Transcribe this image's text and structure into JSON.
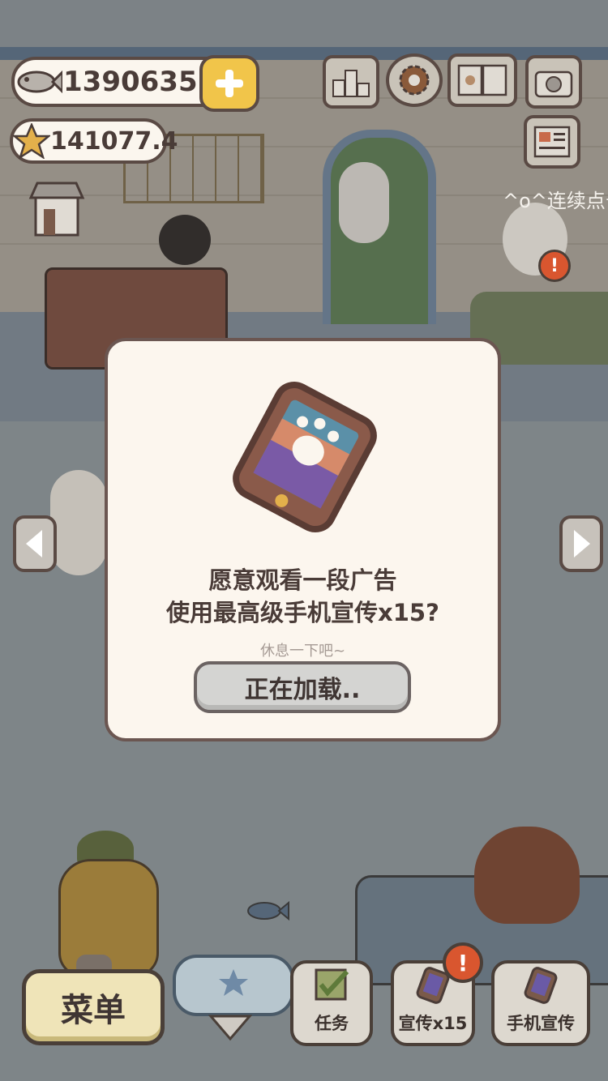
{
  "hud": {
    "fish_count": "1390635",
    "star_count": "141077.4",
    "tap_hint": "^o^连续点击"
  },
  "dialog": {
    "line1": "愿意观看一段广告",
    "line2": "使用最高级手机宣传x15?",
    "hint": "休息一下吧~",
    "button_label": "正在加载.."
  },
  "bottom_bar": {
    "menu_label": "菜单",
    "tasks_label": "任务",
    "promo15_label": "宣传x15",
    "phone_promo_label": "手机宣传",
    "alert_mark": "!"
  },
  "colors": {
    "dialog_bg": "#fcf6ee",
    "button_gray": "#d4d4d2",
    "plus_yellow": "#f1c54a",
    "alert_orange": "#d9562f"
  },
  "icons": [
    "fish-icon",
    "star-icon",
    "plus-icon",
    "ranking-icon",
    "gear-icon",
    "book-icon",
    "camera-icon",
    "newspaper-icon",
    "shop-icon",
    "phone-promo-icon",
    "checklist-icon",
    "chevron-down-icon",
    "arrow-left-icon",
    "arrow-right-icon"
  ]
}
